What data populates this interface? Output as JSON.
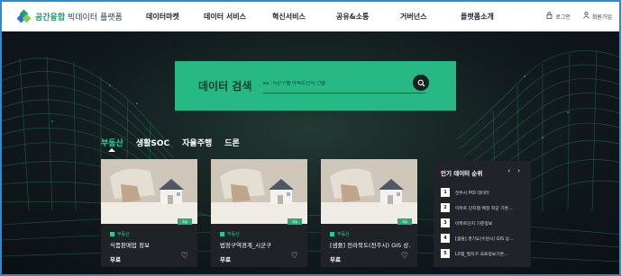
{
  "header": {
    "logo_main": "공간융합",
    "logo_sub": " 빅데이터 플랫폼",
    "nav": [
      "데이터마켓",
      "데이터 서비스",
      "혁신서비스",
      "공유&소통",
      "거버넌스",
      "플랫폼소개"
    ],
    "login_label": "로그인",
    "signup_label": "회원가입",
    "login_icon": "lock-icon",
    "signup_icon": "person-icon"
  },
  "search": {
    "title": "데이터 검색",
    "placeholder": "ex. 시군구별 아파트단지 건물",
    "button_icon": "search-icon"
  },
  "tabs": [
    "부동산",
    "생활SOC",
    "자율주행",
    "드론"
  ],
  "active_tab": 0,
  "cards": [
    {
      "badge": "zip",
      "category": "부동산",
      "title": "식품판매업 정보",
      "price": "무료"
    },
    {
      "badge": "zip",
      "category": "부동산",
      "title": "법정구역경계_시군구",
      "price": "무료"
    },
    {
      "badge": "zip",
      "category": "부동산",
      "title": "[샘플] 전라북도(전주시) GIS 상...",
      "price": "무료"
    }
  ],
  "popular": {
    "title": "인기 데이터 순위",
    "prev_label": "‹",
    "next_label": "›",
    "items": [
      {
        "rank": "1",
        "label": "전주시 POI 데이터"
      },
      {
        "rank": "2",
        "label": "아파트 단지별 배정 학군 기본..."
      },
      {
        "rank": "3",
        "label": "아파트단지 기준정보"
      },
      {
        "rank": "4",
        "label": "[샘플] 경기도(수원시) GIS 상..."
      },
      {
        "rank": "5",
        "label": "LX맵_필지구 국토정보기본..."
      }
    ]
  },
  "colors": {
    "accent": "#27b985",
    "frame": "#2c8bd6",
    "background": "#0d1016"
  }
}
